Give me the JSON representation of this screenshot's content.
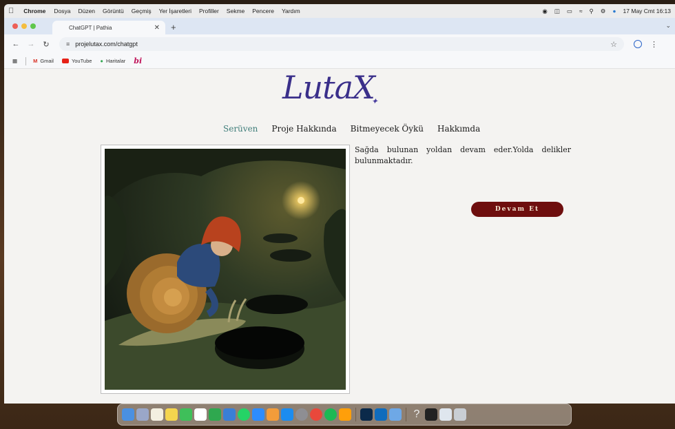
{
  "menubar": {
    "app": "Chrome",
    "items": [
      "Dosya",
      "Düzen",
      "Görüntü",
      "Geçmiş",
      "Yer İşaretleri",
      "Profiller",
      "Sekme",
      "Pencere",
      "Yardım"
    ],
    "clock": "17 May Cmt 16:13"
  },
  "browser": {
    "tab_title": "ChatGPT | Pathia",
    "url": "projelutax.com/chatgpt",
    "bookmarks": [
      "Gmail",
      "YouTube",
      "Haritalar"
    ],
    "bookmark_bi": "bi"
  },
  "site": {
    "logo": "LutaX",
    "nav": [
      "Serüven",
      "Proje Hakkında",
      "Bitmeyecek Öykü",
      "Hakkımda"
    ],
    "story_text": "Sağda bulunan yoldan devam eder.Yolda delikler bulunmaktadır.",
    "continue_label": "Devam Et"
  },
  "colors": {
    "accent_nav": "#3f7d7a",
    "button_bg": "#6e0e0e",
    "logo": "#3a2f8a"
  },
  "dock": {
    "icons": [
      "finder-icon",
      "launchpad-icon",
      "notes-icon",
      "stickies-icon",
      "facetime-icon",
      "calendar-icon",
      "numbers-icon",
      "keynote-icon",
      "whatsapp-icon",
      "zoom-icon",
      "pages-icon",
      "app-store-icon",
      "settings-icon",
      "chrome-icon",
      "spotify-icon",
      "books-icon",
      "photoshop-icon",
      "outlook-icon",
      "preview-icon",
      "help-icon",
      "activity-monitor-icon",
      "screenshot-icon",
      "trash-icon"
    ]
  }
}
